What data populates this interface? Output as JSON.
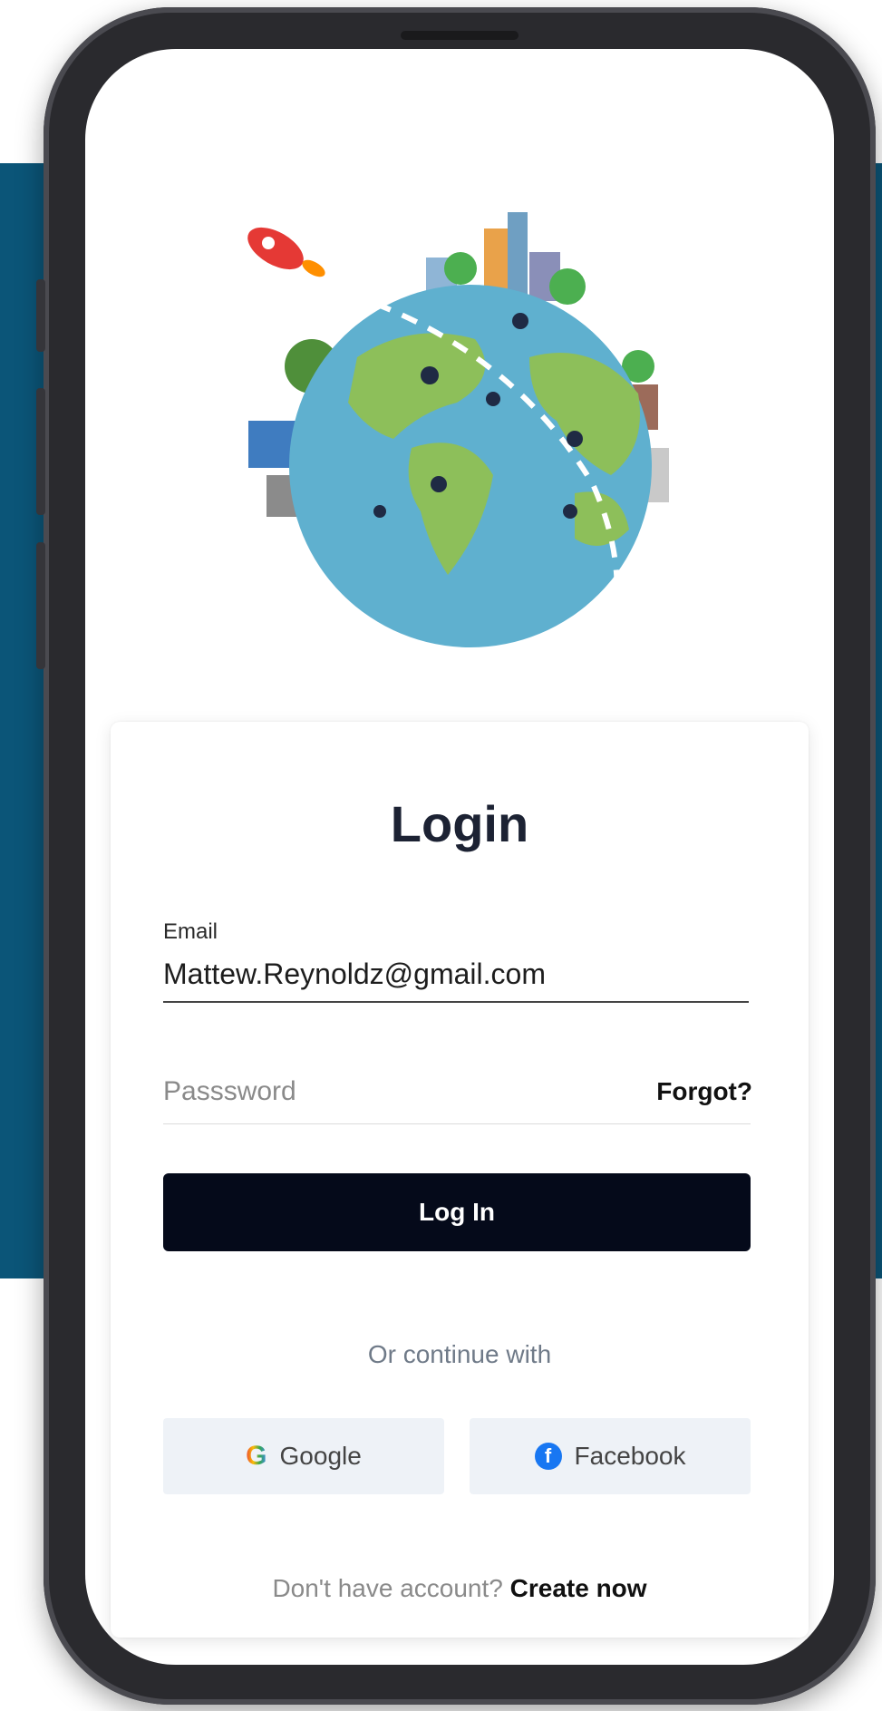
{
  "login": {
    "title": "Login",
    "email_label": "Email",
    "email_value": "Mattew.Reynoldz@gmail.com",
    "password_placeholder": "Passsword",
    "forgot_label": "Forgot?",
    "login_button_label": "Log In",
    "divider_text": "Or continue with",
    "google_label": "Google",
    "facebook_label": "Facebook",
    "signup_prompt": "Don't have account?",
    "signup_link": "Create now"
  },
  "icons": {
    "google": "google-icon",
    "facebook": "facebook-icon",
    "illustration": "globe-illustration"
  },
  "colors": {
    "backdrop": "#0b5578",
    "button_bg": "#050a1a",
    "social_bg": "#eef2f7",
    "title": "#1c2233",
    "ocean": "#5fb0cf",
    "land": "#8dbf5a"
  }
}
